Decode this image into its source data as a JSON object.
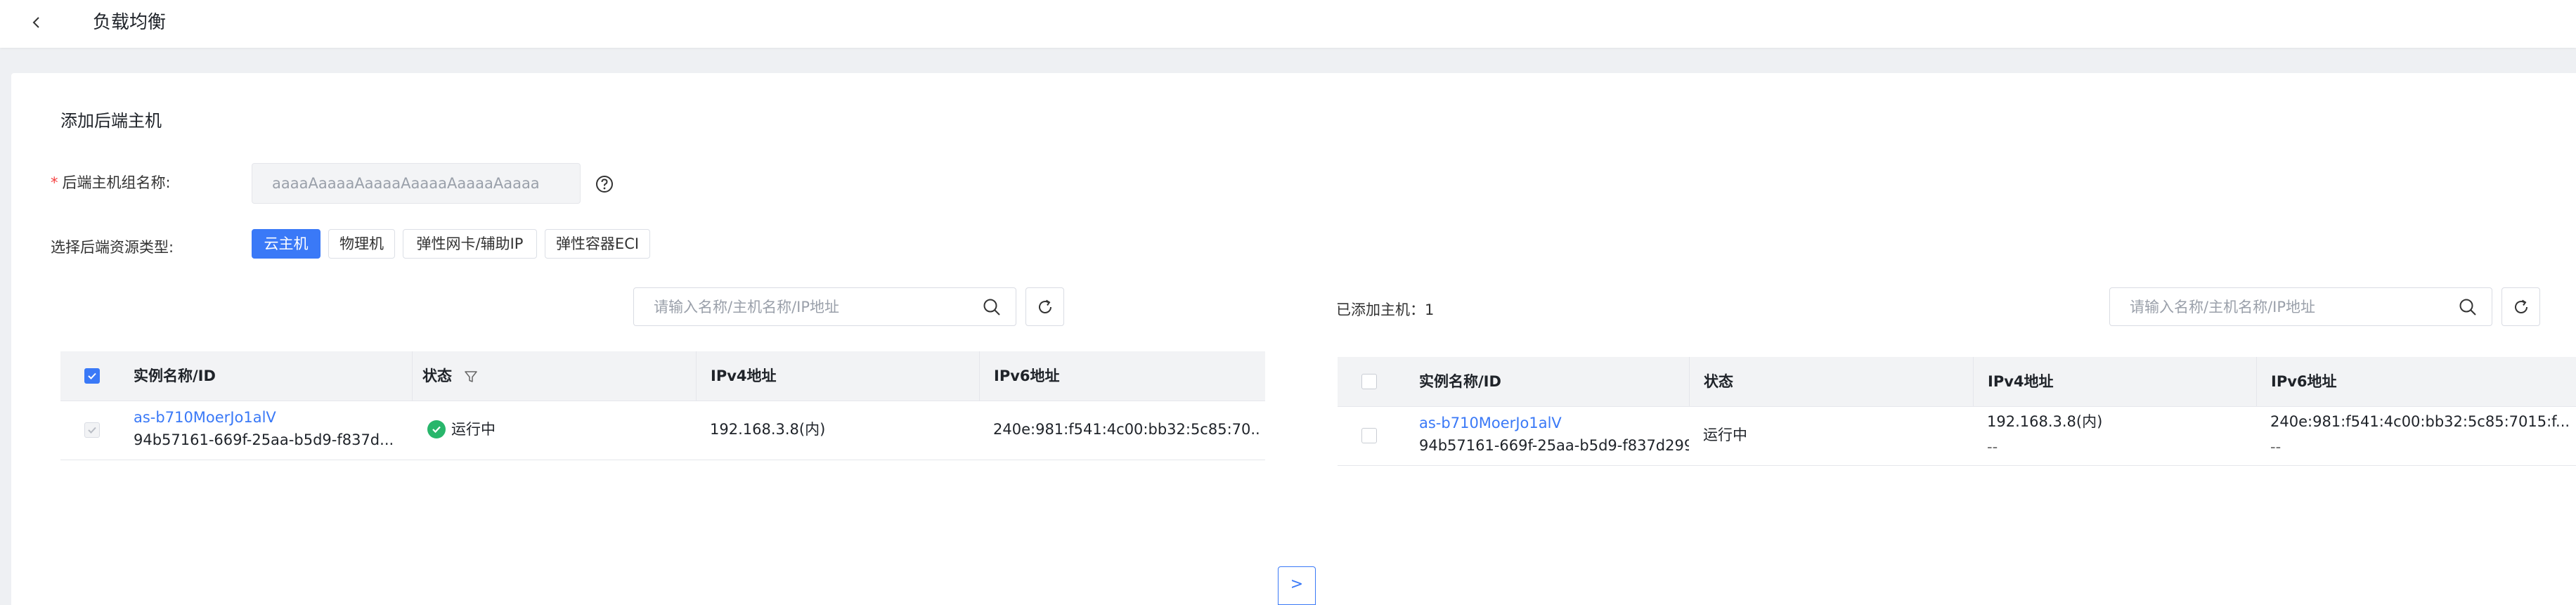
{
  "header": {
    "title": "负载均衡",
    "back_icon": "chevron-left-icon"
  },
  "form": {
    "section_title": "添加后端主机",
    "group_name_label": "后端主机组名称:",
    "required_mark": "*",
    "group_name_placeholder": "aaaaAaaaaAaaaaAaaaaAaaaaAaaaa",
    "help_icon": "question-circle-icon",
    "resource_type_label": "选择后端资源类型:",
    "resource_types": [
      {
        "label": "云主机",
        "active": true
      },
      {
        "label": "物理机",
        "active": false
      },
      {
        "label": "弹性网卡/辅助IP",
        "active": false
      },
      {
        "label": "弹性容器ECI",
        "active": false
      }
    ]
  },
  "left_panel": {
    "search_placeholder": "请输入名称/主机名称/IP地址",
    "columns": [
      "实例名称/ID",
      "状态",
      "IPv4地址",
      "IPv6地址"
    ],
    "select_all_checked": true,
    "rows": [
      {
        "name": "as-b710MoerJo1alV",
        "id": "94b57161-669f-25aa-b5d9-f837d...",
        "status": "运行中",
        "ipv4": "192.168.3.8(内)",
        "ipv6": "240e:981:f541:4c00:bb32:5c85:70...",
        "checked": true,
        "disabled": true
      }
    ]
  },
  "right_panel": {
    "added_label": "已添加主机：1",
    "search_placeholder": "请输入名称/主机名称/IP地址",
    "columns": [
      "实例名称/ID",
      "状态",
      "IPv4地址",
      "IPv6地址"
    ],
    "rows": [
      {
        "name": "as-b710MoerJo1alV",
        "id": "94b57161-669f-25aa-b5d9-f837d299",
        "status": "运行中",
        "ipv4": "192.168.3.8(内)",
        "ipv4_extra": "--",
        "ipv6": "240e:981:f541:4c00:bb32:5c85:7015:f...",
        "ipv6_extra": "--"
      }
    ]
  },
  "transfer_button": ">",
  "colors": {
    "primary": "#3a79f7",
    "success": "#28b66b",
    "required": "#f53f3f"
  }
}
